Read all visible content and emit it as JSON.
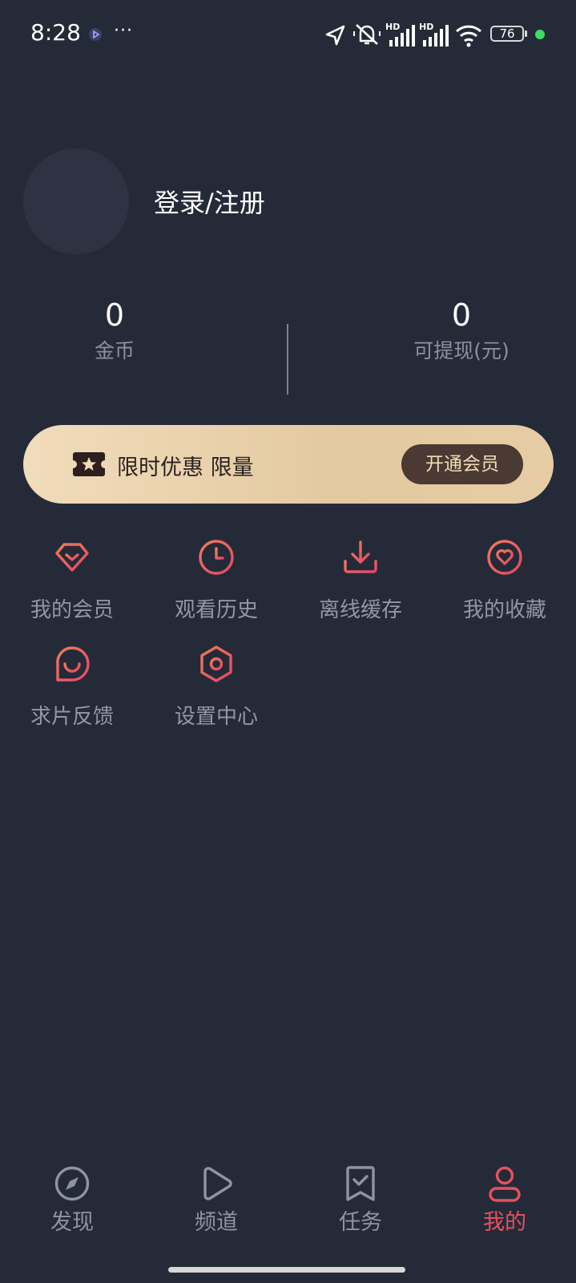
{
  "status_bar": {
    "time": "8:28",
    "more": "···",
    "battery": "76",
    "net1": "HD",
    "net2": "HD"
  },
  "profile": {
    "login_label": "登录/注册"
  },
  "stats": [
    {
      "value": "0",
      "label": "金币"
    },
    {
      "value": "0",
      "label": "可提现(元)"
    }
  ],
  "vip_banner": {
    "text": "限时优惠 限量",
    "button": "开通会员"
  },
  "menu": [
    {
      "label": "我的会员",
      "icon": "diamond-icon"
    },
    {
      "label": "观看历史",
      "icon": "clock-icon"
    },
    {
      "label": "离线缓存",
      "icon": "download-icon"
    },
    {
      "label": "我的收藏",
      "icon": "heart-icon"
    },
    {
      "label": "求片反馈",
      "icon": "chat-icon"
    },
    {
      "label": "设置中心",
      "icon": "settings-icon"
    }
  ],
  "nav": [
    {
      "label": "发现",
      "icon": "compass-icon"
    },
    {
      "label": "频道",
      "icon": "play-icon"
    },
    {
      "label": "任务",
      "icon": "task-icon"
    },
    {
      "label": "我的",
      "icon": "user-icon",
      "active": true
    }
  ],
  "colors": {
    "background": "#252a38",
    "accent": "#e8505f",
    "vip_gold": "#e3c9a0"
  }
}
